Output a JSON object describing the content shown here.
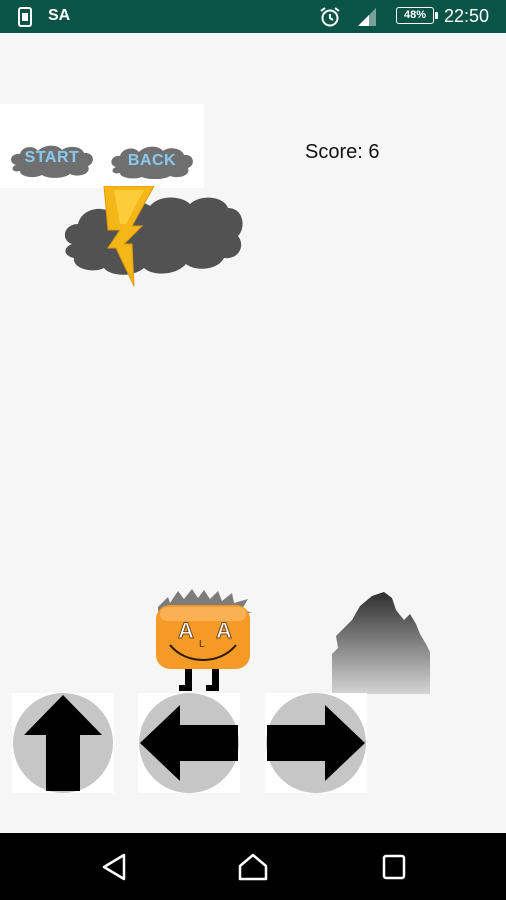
{
  "status_bar": {
    "carrier": "SA",
    "battery": "48%",
    "time": "22:50"
  },
  "menu": {
    "start_label": "START",
    "back_label": "BACK"
  },
  "hud": {
    "score_text": "Score: 6"
  },
  "player": {
    "face_text": "A L A"
  },
  "controls": [
    {
      "name": "jump",
      "icon": "arrow-up-icon"
    },
    {
      "name": "move-left",
      "icon": "arrow-left-icon"
    },
    {
      "name": "move-right",
      "icon": "arrow-right-icon"
    }
  ],
  "colors": {
    "status_bar": "#0a5447",
    "cloud_button": "#6a6a6a",
    "button_text": "#8ec7e6",
    "storm_cloud": "#505050",
    "lightning": "#f4b414",
    "player": "#f49a2a",
    "control_circle": "#c6c6c6"
  }
}
